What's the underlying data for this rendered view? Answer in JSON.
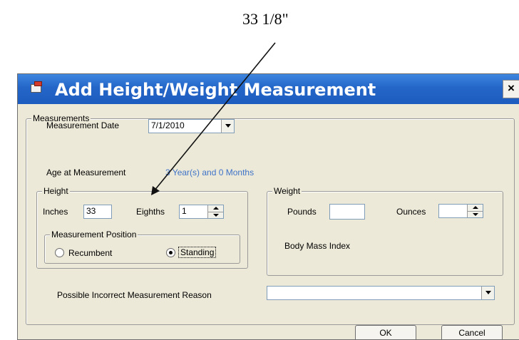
{
  "annotation": {
    "text": "33 1/8\""
  },
  "dialog": {
    "title": "Add Height/Weight Measurement",
    "close_label": "×"
  },
  "measurements": {
    "legend": "Measurements",
    "date_label": "Measurement Date",
    "date_value": "7/1/2010",
    "age_label": "Age at Measurement",
    "age_value": "3 Year(s) and 0 Months"
  },
  "height": {
    "legend": "Height",
    "inches_label": "Inches",
    "inches_value": "33",
    "eighths_label": "Eighths",
    "eighths_value": "1",
    "position": {
      "legend": "Measurement Position",
      "recumbent_label": "Recumbent",
      "standing_label": "Standing",
      "selected": "Standing"
    }
  },
  "weight": {
    "legend": "Weight",
    "pounds_label": "Pounds",
    "pounds_value": "",
    "ounces_label": "Ounces",
    "ounces_value": "",
    "bmi_label": "Body Mass Index"
  },
  "reason": {
    "label": "Possible Incorrect Measurement Reason",
    "value": ""
  },
  "buttons": {
    "ok": "OK",
    "cancel": "Cancel"
  },
  "colors": {
    "titlebar": "#2466c8",
    "dialog_bg": "#ece9d8",
    "link": "#3f73c8"
  }
}
